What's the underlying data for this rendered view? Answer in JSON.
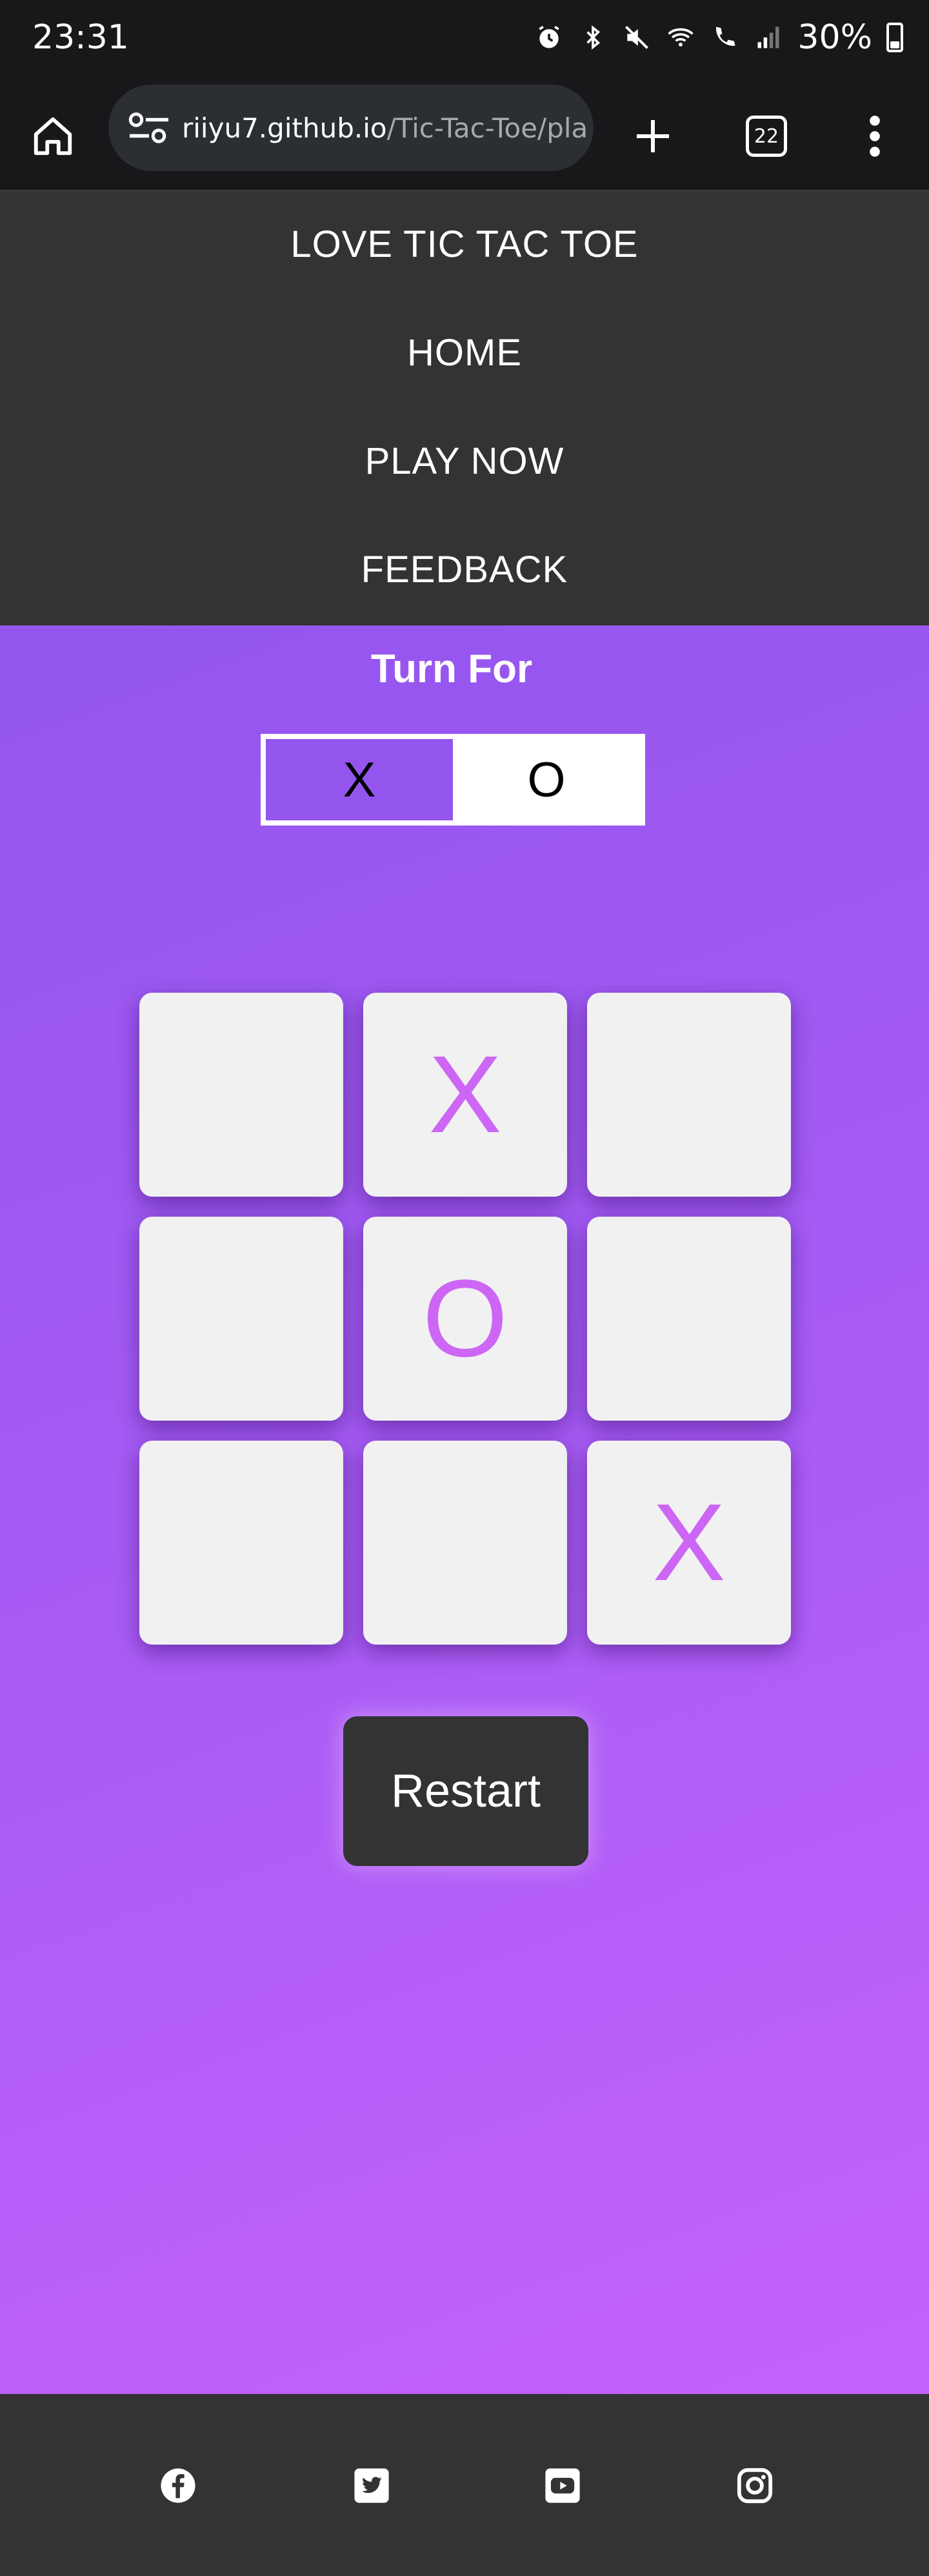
{
  "status_bar": {
    "time": "23:31",
    "battery": "30%",
    "icons": [
      "alarm-icon",
      "bluetooth-icon",
      "mute-icon",
      "wifi-calling-icon",
      "call-icon",
      "signal-icon",
      "battery-icon"
    ]
  },
  "browser": {
    "url_host": "riiyu7.github.io",
    "url_path": "/Tic-Tac-Toe/pla",
    "tab_count": "22"
  },
  "nav": {
    "brand": "LOVE TIC TAC TOE",
    "items": [
      "HOME",
      "PLAY NOW",
      "FEEDBACK"
    ]
  },
  "game": {
    "turn_label": "Turn For",
    "turn_options": [
      "X",
      "O"
    ],
    "active_turn": "X",
    "board": [
      "",
      "X",
      "",
      "",
      "O",
      "",
      "",
      "",
      "X"
    ],
    "restart_label": "Restart"
  },
  "colors": {
    "accent": "#9355ee",
    "mark": "#cd66f5",
    "dark": "#333333"
  },
  "footer": {
    "social": [
      "facebook-icon",
      "twitter-icon",
      "youtube-icon",
      "instagram-icon"
    ]
  }
}
